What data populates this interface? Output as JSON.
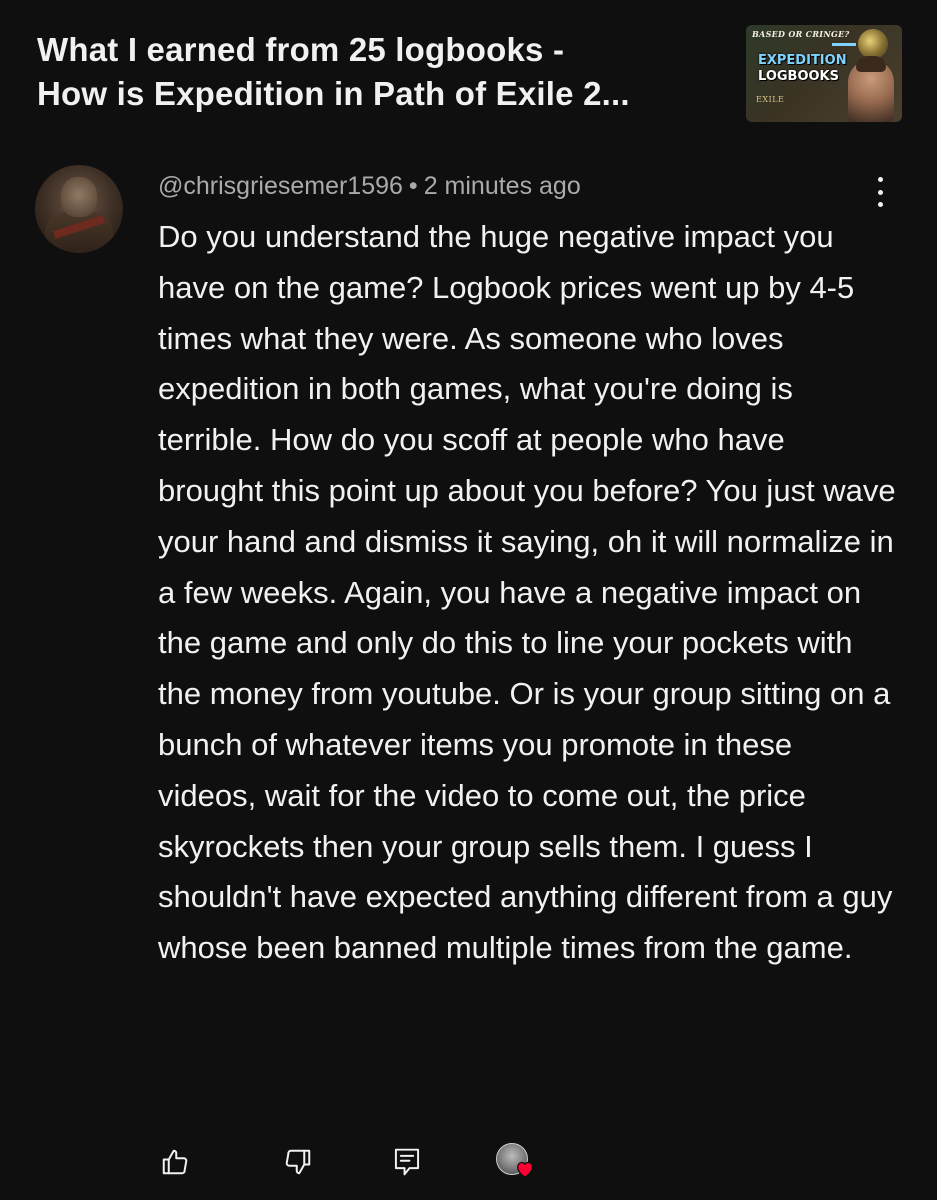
{
  "video": {
    "title": "What I earned from 25 logbooks -\nHow is Expedition in Path of Exile 2...",
    "thumbnail": {
      "top_text": "BASED OR CRINGE?",
      "main_line1": "EXPEDITION",
      "main_line2": "LOGBOOKS",
      "game_text": "EXILE"
    }
  },
  "comment": {
    "author": "@chrisgriesemer1596",
    "separator": "•",
    "timestamp": "2 minutes ago",
    "text": "Do you understand the huge negative impact you have on the game? Logbook prices went up by 4-5 times what they were. As someone who loves expedition in both games, what you're doing is terrible. How do you scoff at people who have brought this point up about you before? You just wave your hand and dismiss it saying, oh it will normalize in a few weeks. Again, you have a negative impact on the game and only do this to line your pockets with the money from youtube. Or is your group sitting on a bunch of whatever items you promote in these videos, wait for the video to come out, the price skyrockets then your group sells them. I guess I shouldn't have expected anything different from a guy whose been banned multiple times from the game."
  },
  "actions": {
    "like_icon": "thumb-up-icon",
    "dislike_icon": "thumb-down-icon",
    "reply_icon": "reply-comment-icon",
    "creator_heart_icon": "creator-heart-icon"
  },
  "colors": {
    "background": "#0f0f0f",
    "text_primary": "#f1f1f1",
    "text_secondary": "#aaaaaa",
    "heart": "#ff0033"
  }
}
